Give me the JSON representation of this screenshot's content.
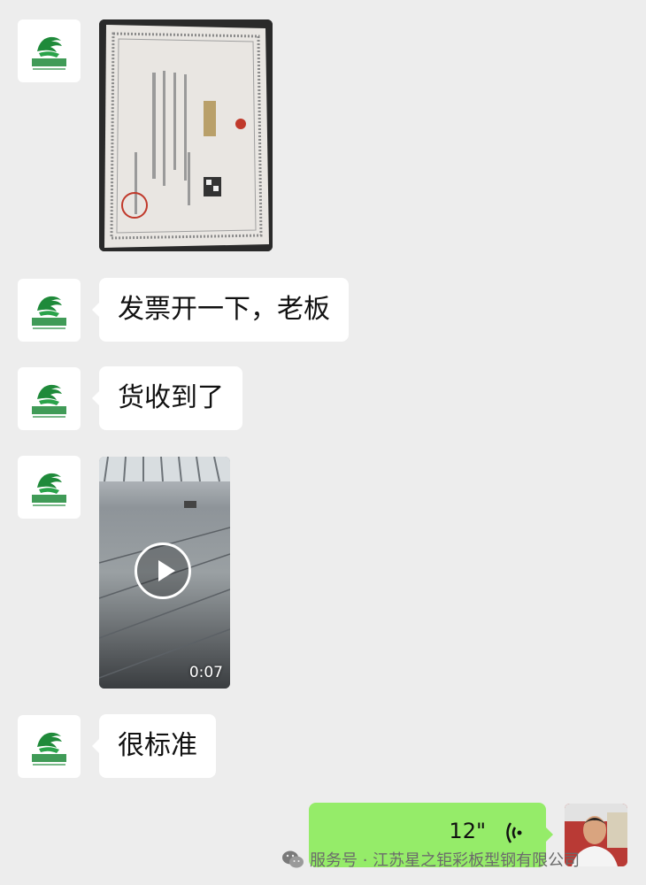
{
  "conversation": {
    "messages": [
      {
        "type": "image",
        "description": "business-license-photo"
      },
      {
        "type": "text",
        "text": "发票开一下，老板"
      },
      {
        "type": "text",
        "text": "货收到了"
      },
      {
        "type": "video",
        "duration": "0:07"
      },
      {
        "type": "text",
        "text": "很标准"
      },
      {
        "type": "voice",
        "duration": "12\""
      }
    ]
  },
  "watermark": {
    "text": "服务号 · 江苏星之钜彩板型钢有限公司"
  },
  "colors": {
    "background": "#ededed",
    "incoming_bubble": "#ffffff",
    "outgoing_bubble": "#95ec69"
  }
}
